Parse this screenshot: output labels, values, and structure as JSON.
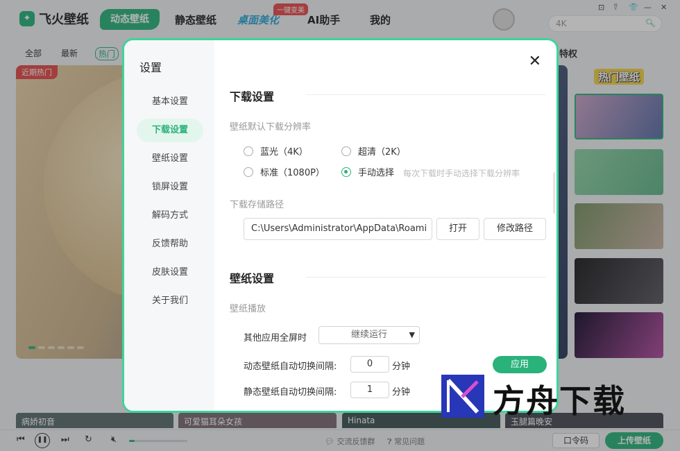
{
  "app": {
    "logo": "飞火壁纸",
    "nav": [
      "动态壁纸",
      "静态壁纸",
      "桌面美化",
      "AI助手",
      "我的"
    ],
    "nav_badge": "一键变美",
    "window_controls": [
      "⊡",
      "⍢",
      "👕",
      "—",
      "✕"
    ],
    "search_value": "4K",
    "filters": [
      "全部",
      "最新",
      "热门"
    ],
    "filter_right": "特权",
    "hero_tag": "近期热门",
    "hot_title": "热门壁纸",
    "bottom_cards": [
      "病娇初音",
      "可爱猫耳朵女孩",
      "Hinata",
      "玉腿篇晚安"
    ],
    "player": {
      "volume_fraction": 0.1,
      "feedback_link": "交流反馈群",
      "faq_link": "常见问题",
      "code_button": "口令码",
      "upload_button": "上传壁纸"
    }
  },
  "dialog": {
    "title": "设置",
    "close_glyph": "✕",
    "side_menu": [
      "基本设置",
      "下载设置",
      "壁纸设置",
      "锁屏设置",
      "解码方式",
      "反馈帮助",
      "皮肤设置",
      "关于我们"
    ],
    "active_side_index": 1,
    "download": {
      "section_title": "下载设置",
      "resolution_label": "壁纸默认下载分辨率",
      "options": [
        {
          "label": "蓝光（4K）",
          "checked": false
        },
        {
          "label": "超清（2K）",
          "checked": false
        },
        {
          "label": "标准（1080P）",
          "checked": false
        },
        {
          "label": "手动选择",
          "checked": true
        }
      ],
      "manual_hint": "每次下载时手动选择下载分辨率",
      "path_label": "下载存储路径",
      "path_value": "C:\\Users\\Administrator\\AppData\\Roami",
      "open_button": "打开",
      "change_button": "修改路径"
    },
    "wallpaper": {
      "section_title": "壁纸设置",
      "play_label": "壁纸播放",
      "fullscreen_label": "其他应用全屏时",
      "fullscreen_value": "继续运行",
      "dynamic_interval_label": "动态壁纸自动切换间隔:",
      "dynamic_interval_value": "0",
      "static_interval_label": "静态壁纸自动切换间隔:",
      "static_interval_value": "1",
      "unit": "分钟",
      "apply_button": "应用"
    }
  },
  "watermark": {
    "text": "方舟下载"
  }
}
